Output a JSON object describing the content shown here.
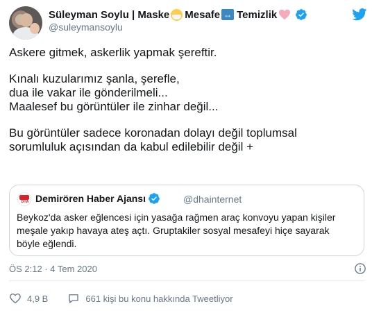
{
  "author": {
    "name": "Süleyman Soylu | Maske",
    "name_part2": "Mesafe",
    "name_part3": "Temizlik",
    "handle": "@suleymansoylu",
    "emoji_icons": [
      "face-with-medical-mask-icon",
      "left-right-arrow-icon",
      "pink-heart-icon"
    ]
  },
  "tweet": {
    "lines_p1": [
      "Askere gitmek, askerlik yapmak şereftir."
    ],
    "lines_p2": [
      "Kınalı kuzularımız şanla, şerefle,",
      "dua ile vakar ile gönderilmeli...",
      "Maalesef bu görüntüler ile zinhar değil..."
    ],
    "lines_p3": [
      "Bu görüntüler sadece koronadan dolayı değil toplumsal",
      "sorumluluk açısından da kabul edilebilir değil +"
    ]
  },
  "quoted": {
    "name": "Demirören Haber Ajansı",
    "handle": "@dhainternet",
    "logo_text": "DHA",
    "lines": [
      "Beykoz'da asker eğlencesi için yasağa rağmen araç konvoyu yapan kişiler",
      "meşale yakıp havaya ateş açtı. Gruptakiler sosyal mesafeyi hiçe sayarak",
      "böyle eğlendi."
    ]
  },
  "meta": {
    "timestamp": "ÖS 2:12 · 4 Tem 2020"
  },
  "actions": {
    "likes": "4,9 B",
    "talking": "661 kişi bu konu hakkında Tweetliyor"
  },
  "colors": {
    "twitter_blue": "#1da1f2",
    "text": "#14171a",
    "muted": "#657786",
    "border": "#ccd6dd"
  }
}
